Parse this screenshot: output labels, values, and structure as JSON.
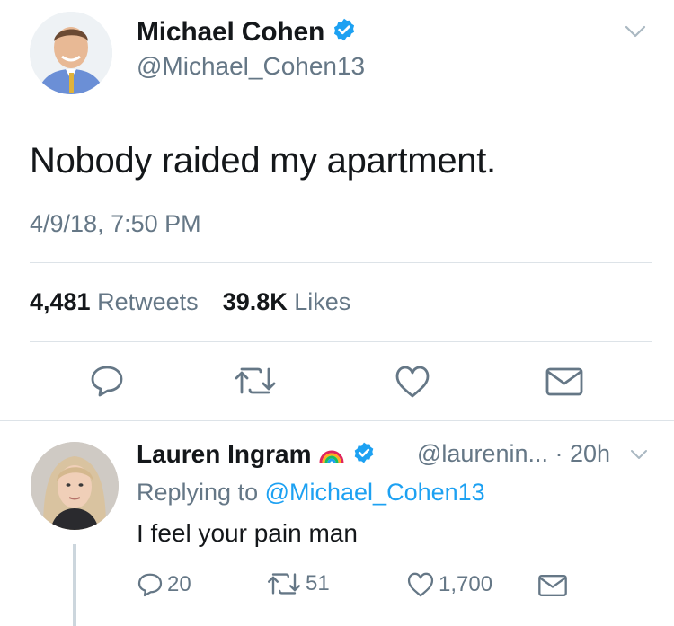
{
  "tweet": {
    "author_name": "Michael Cohen",
    "author_handle": "@Michael_Cohen13",
    "verified": true,
    "text": "Nobody raided my apartment.",
    "timestamp": "4/9/18, 7:50 PM",
    "retweets_count": "4,481",
    "retweets_label": "Retweets",
    "likes_count": "39.8K",
    "likes_label": "Likes",
    "actions": [
      "reply-icon",
      "retweet-icon",
      "like-icon",
      "direct-message-icon"
    ]
  },
  "reply": {
    "author_name": "Lauren Ingram",
    "emoji": "rainbow-icon",
    "verified": true,
    "author_handle": "@laurenin...",
    "separator": "·",
    "time": "20h",
    "replying_prefix": "Replying to",
    "replying_to": "@Michael_Cohen13",
    "text": "I feel your pain man",
    "reply_count": "20",
    "retweet_count": "51",
    "like_count": "1,700"
  },
  "colors": {
    "text": "#14171a",
    "secondary": "#657786",
    "link": "#1da1f2",
    "verified_badge": "#1da1f2",
    "divider": "#dde3e8"
  }
}
